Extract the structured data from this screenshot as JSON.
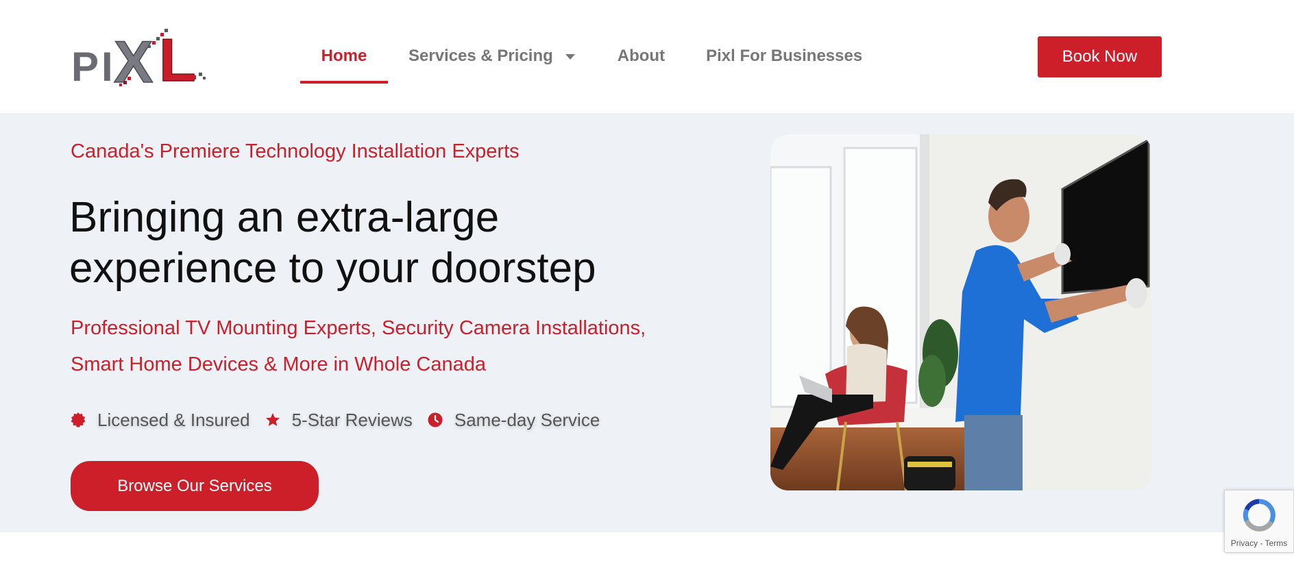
{
  "brand": {
    "logo_text": "PIXL",
    "accent": "#cc1f2a"
  },
  "nav": {
    "home": "Home",
    "services": "Services & Pricing",
    "about": "About",
    "business": "Pixl For Businesses",
    "book_now": "Book Now"
  },
  "hero": {
    "eyebrow": "Canada's Premiere Technology Installation Experts",
    "headline_line1": "Bringing an extra-large",
    "headline_line2": "experience to your doorstep",
    "sub_line1": "Professional TV Mounting Experts, Security Camera Installations,",
    "sub_line2": "Smart Home Devices & More in Whole Canada",
    "features": [
      {
        "icon": "badge-icon",
        "label": "Licensed & Insured"
      },
      {
        "icon": "star-icon",
        "label": "5-Star Reviews"
      },
      {
        "icon": "clock-icon",
        "label": "Same-day Service"
      }
    ],
    "cta": "Browse Our Services"
  },
  "recaptcha": {
    "terms": "Privacy - Terms"
  }
}
